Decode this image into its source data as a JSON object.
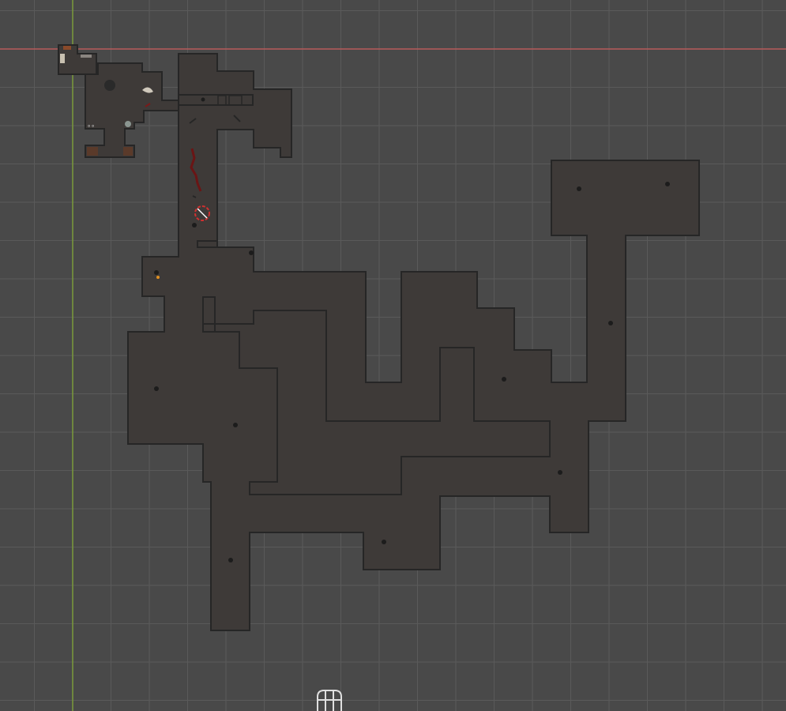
{
  "scene": {
    "background_color": "#494949",
    "grid_color": "#5a5a5a",
    "x_axis_color": "#b85a5a",
    "y_axis_color": "#7a9a3a",
    "floor_color": "#3e3a38",
    "wall_color": "#262626",
    "debris_color": "#7a1a1a",
    "light_marker_color": "#1c1c1c",
    "accent_orange": "#e09020",
    "cursor_color": "#ffffff",
    "cursor_accent": "#d03030"
  },
  "icons": {
    "camera_gizmo": "camera-icon",
    "player_marker": "crosshair-icon",
    "light_markers": "light-dot-icon"
  }
}
